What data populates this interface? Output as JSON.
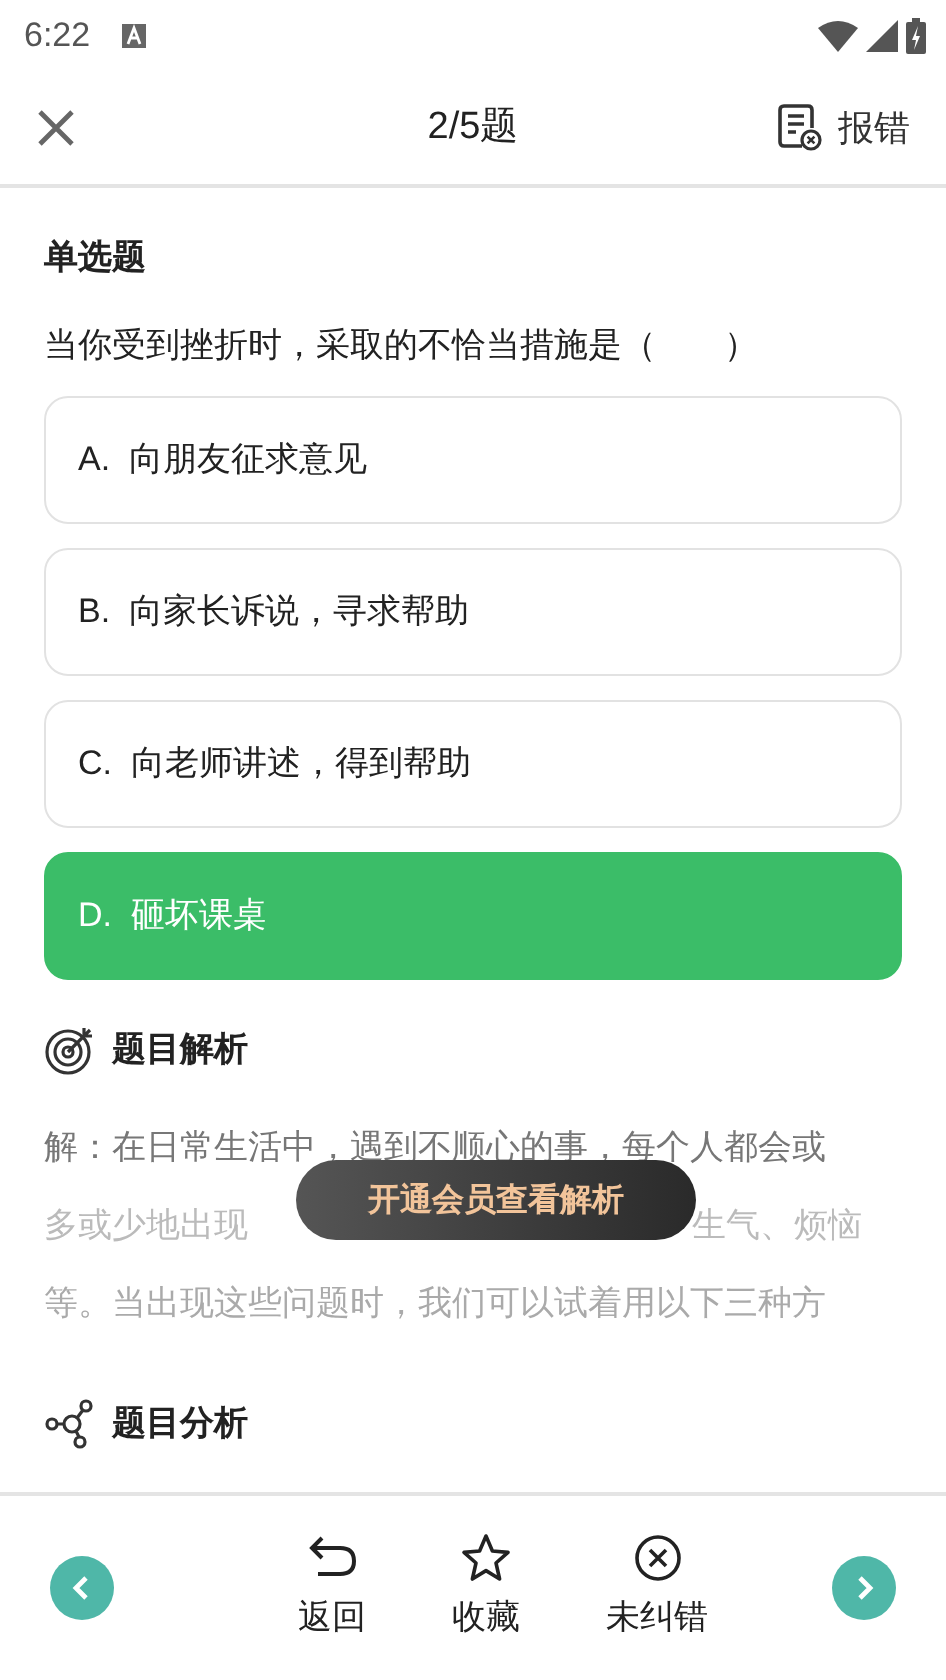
{
  "status_bar": {
    "time": "6:22"
  },
  "header": {
    "progress": "2/5题",
    "report": "报错"
  },
  "question": {
    "type": "单选题",
    "text": "当你受到挫折时，采取的不恰当措施是（　　）",
    "options": [
      {
        "letter": "A.",
        "text": "向朋友征求意见",
        "selected": false
      },
      {
        "letter": "B.",
        "text": "向家长诉说，寻求帮助",
        "selected": false
      },
      {
        "letter": "C.",
        "text": "向老师讲述，得到帮助",
        "selected": false
      },
      {
        "letter": "D.",
        "text": "砸坏课桌",
        "selected": true
      }
    ]
  },
  "explanation": {
    "title": "题目解析",
    "line_1": "解：在日常生活中，遇到不顺心的事，每个人都会或",
    "line_2_start": "多或少地出现",
    "line_2_end": "生气、烦恼",
    "line_3": "等。当出现这些问题时，我们可以试着用以下三种方",
    "unlock_button": "开通会员查看解析"
  },
  "analysis": {
    "title": "题目分析"
  },
  "bottom_bar": {
    "actions": [
      {
        "kind": "back",
        "label": "返回"
      },
      {
        "kind": "favorite",
        "label": "收藏"
      },
      {
        "kind": "error",
        "label": "未纠错"
      }
    ]
  }
}
